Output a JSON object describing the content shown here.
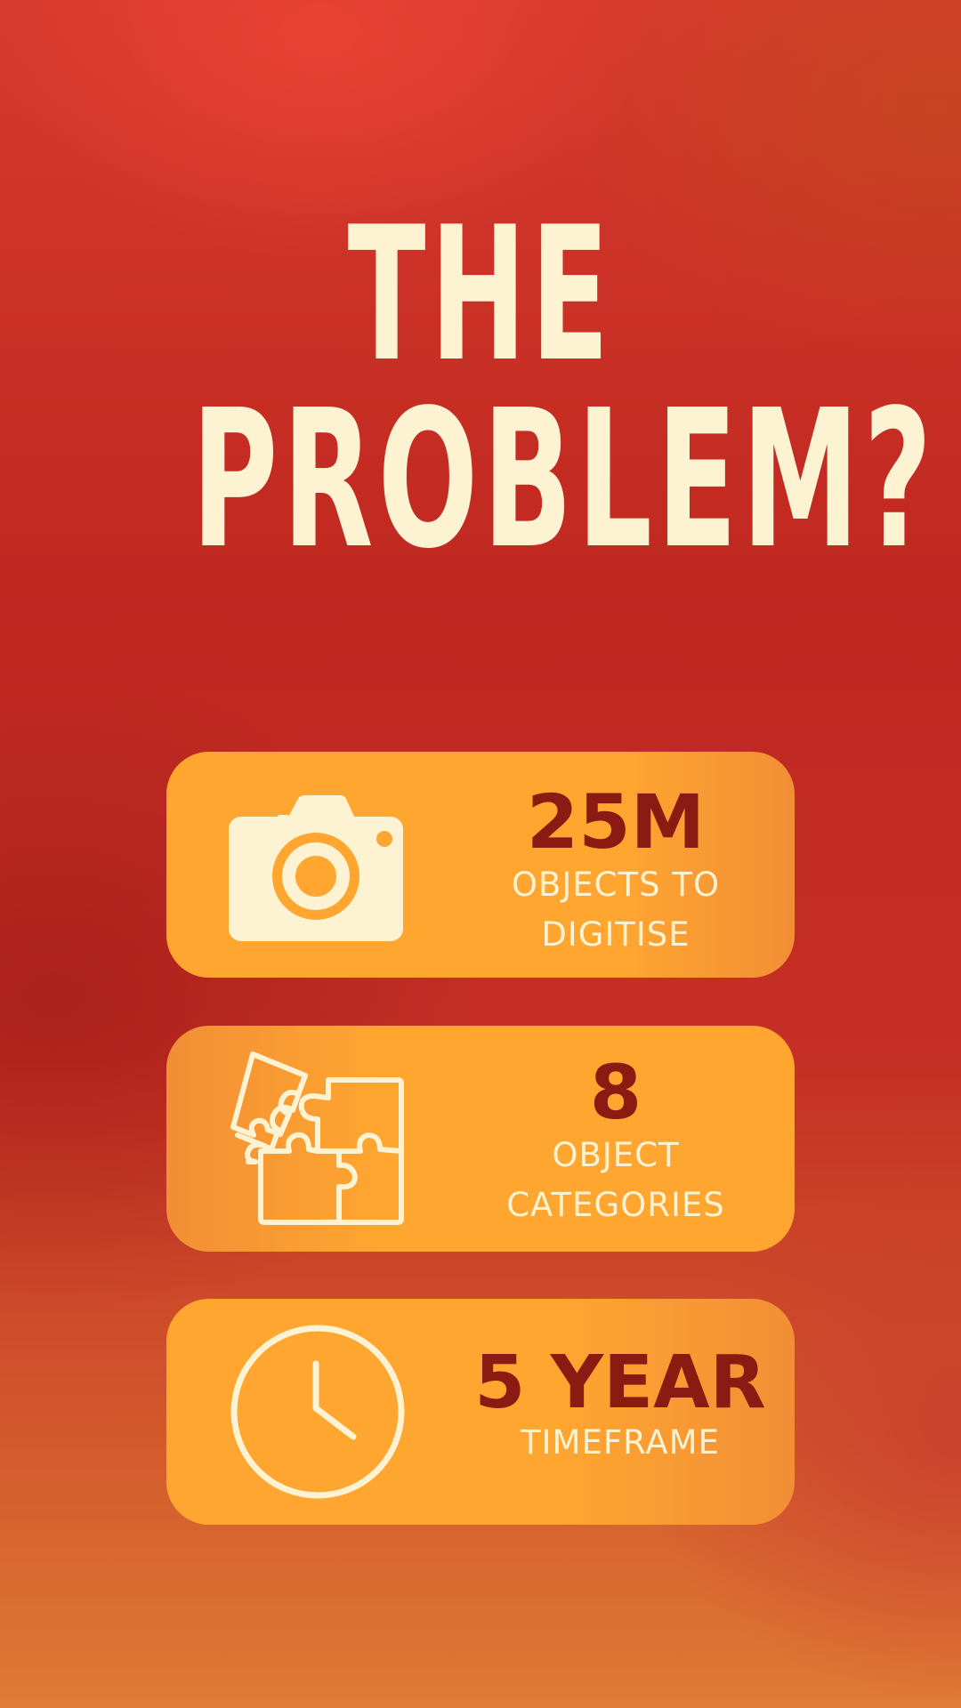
{
  "title": {
    "line1": "THE",
    "line2": "PROBLEM?"
  },
  "colors": {
    "background_top": "#d63a2e",
    "background_bottom": "#e07a35",
    "card": "#ffa631",
    "title_text": "#fdf3d2",
    "value_text": "#8a1a12",
    "label_text": "#fdf3d2"
  },
  "cards": [
    {
      "icon": "camera-icon",
      "value": "25M",
      "label": "OBJECTS TO DIGITISE"
    },
    {
      "icon": "puzzle-icon",
      "value": "8",
      "label": "OBJECT CATEGORIES"
    },
    {
      "icon": "clock-icon",
      "value": "5 YEAR",
      "label": "TIMEFRAME"
    }
  ]
}
